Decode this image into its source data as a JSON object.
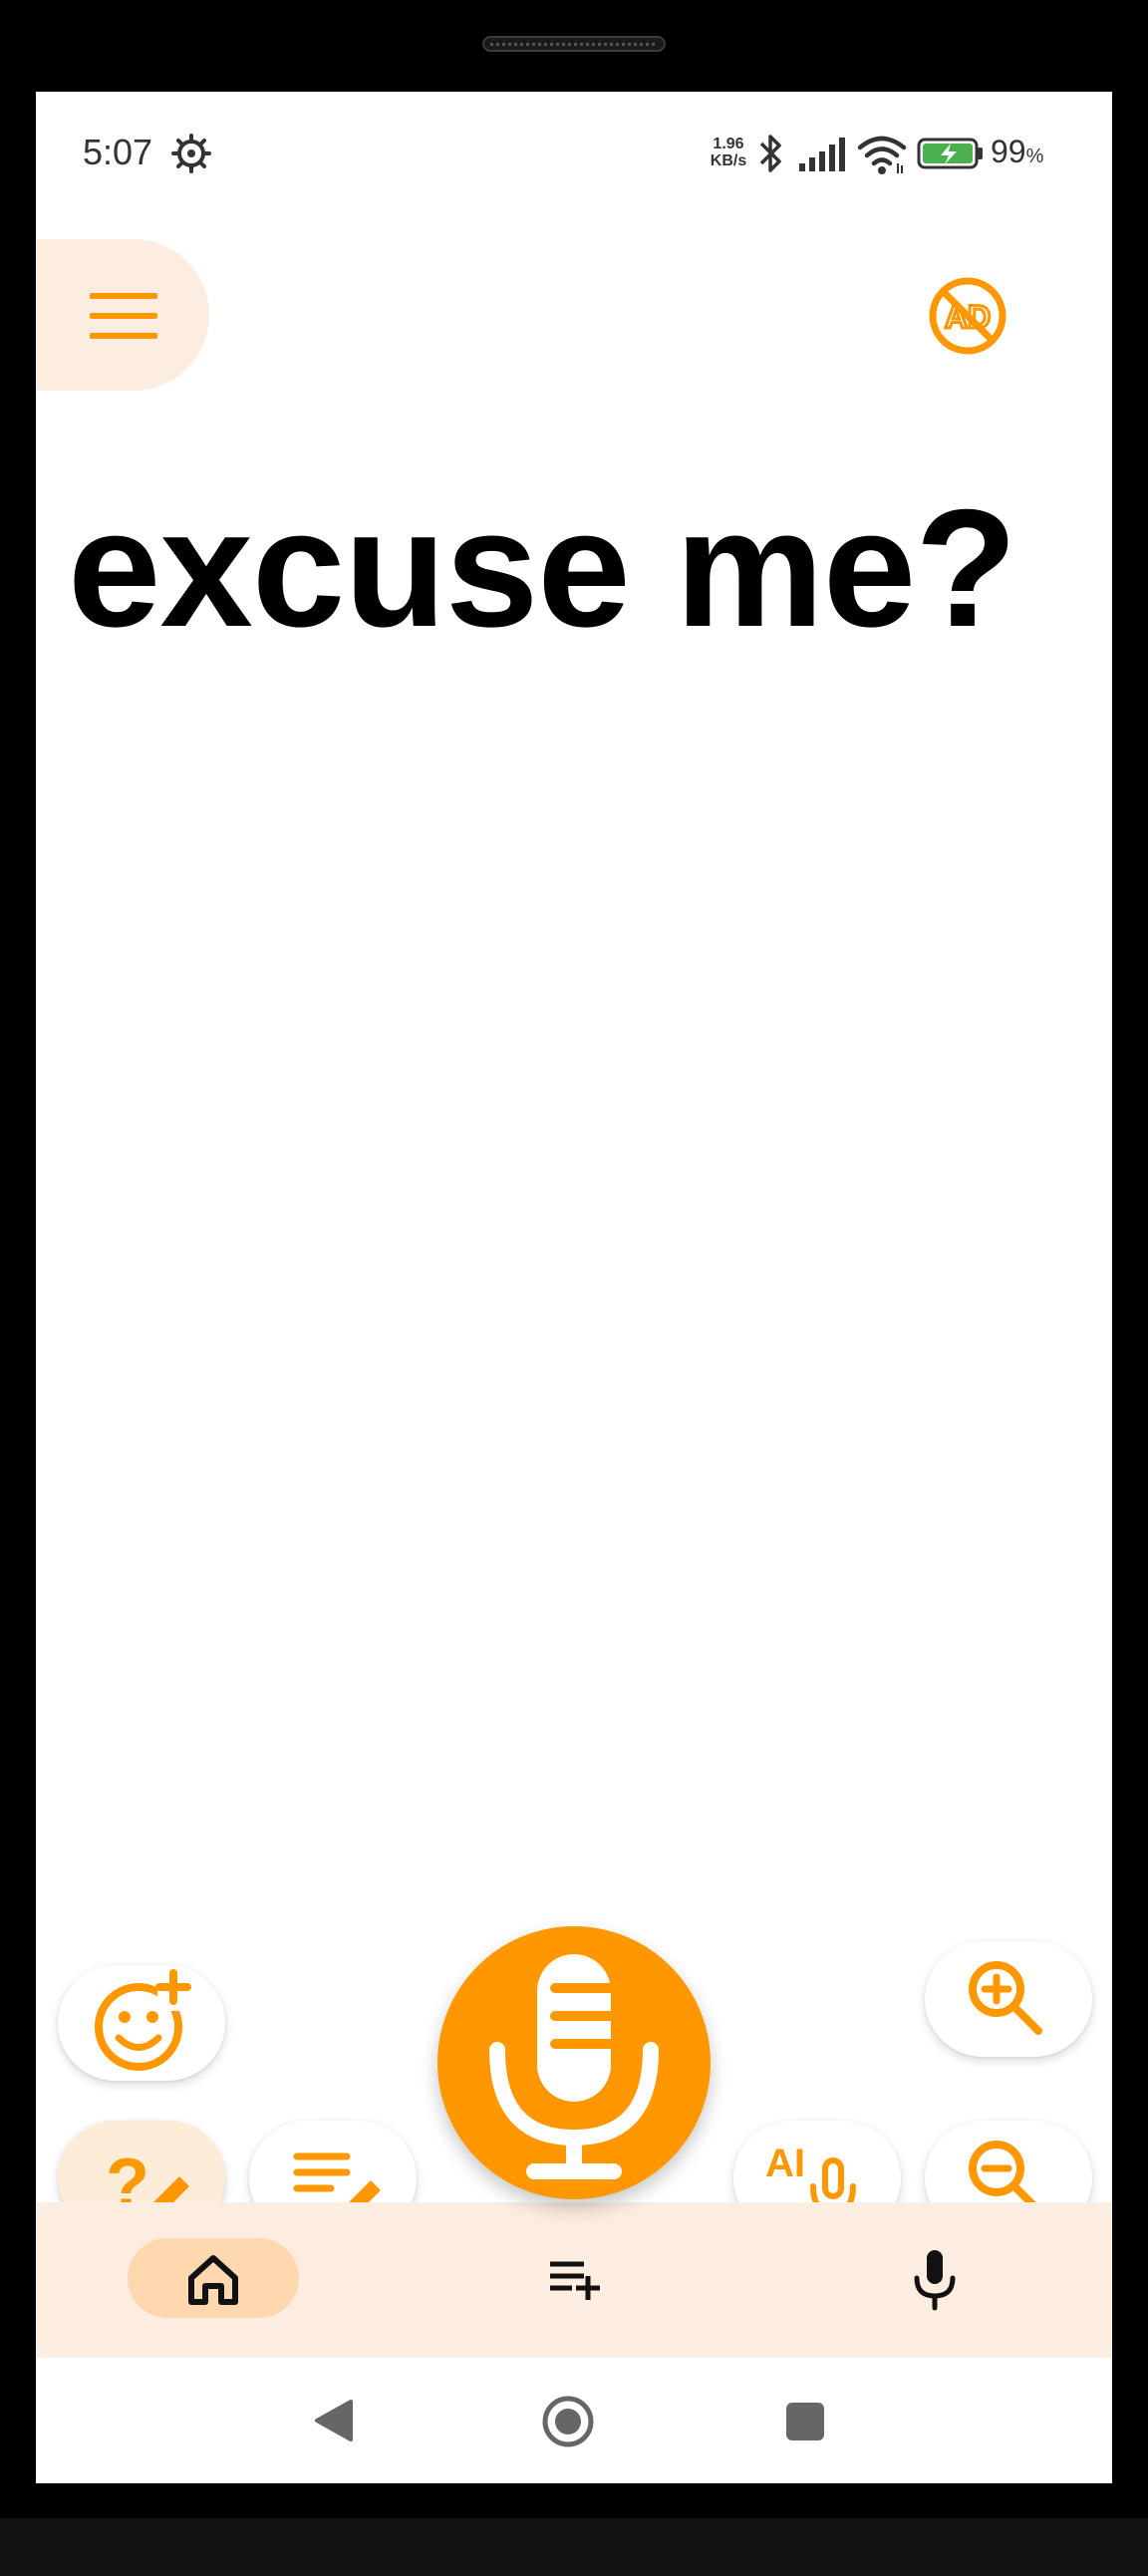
{
  "status_bar": {
    "time": "5:07",
    "net_speed_value": "1.96",
    "net_speed_unit": "KB/s",
    "battery_percent": "99",
    "battery_suffix": "%"
  },
  "main": {
    "text": "excuse me?"
  },
  "toolbar": {
    "ai_label": "AI"
  },
  "colors": {
    "accent": "#ff9800",
    "nav_background": "#fdece0",
    "active_pill": "#fdecd8"
  },
  "icons": {
    "menu": "hamburger-menu-icon",
    "no_ads": "no-ads-icon",
    "add_emoji": "add-emoji-icon",
    "zoom_in": "zoom-in-icon",
    "zoom_out": "zoom-out-icon",
    "edit_question": "question-edit-icon",
    "edit_text": "text-edit-icon",
    "microphone": "microphone-icon",
    "ai_voice": "ai-microphone-icon",
    "home": "home-icon",
    "playlist_add": "playlist-add-icon",
    "nav_mic": "mic-icon"
  }
}
